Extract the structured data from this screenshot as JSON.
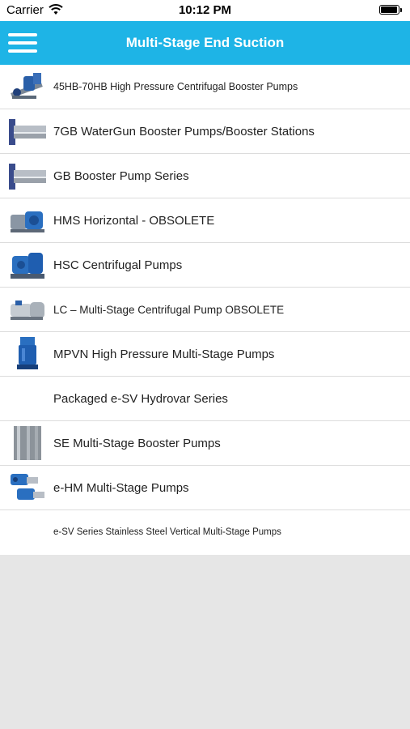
{
  "status_bar": {
    "carrier": "Carrier",
    "time": "10:12 PM",
    "wifi_icon": "wifi-icon",
    "battery_icon": "battery-icon"
  },
  "nav": {
    "title": "Multi-Stage End Suction",
    "menu_icon": "hamburger-menu-icon",
    "accent_color": "#1eb4e6"
  },
  "items": [
    {
      "label": "45HB-70HB High Pressure Centrifugal Booster Pumps",
      "thumb": "pump-image"
    },
    {
      "label": "7GB WaterGun Booster Pumps/Booster Stations",
      "thumb": "pump-image"
    },
    {
      "label": "GB Booster Pump Series",
      "thumb": "pump-image"
    },
    {
      "label": "HMS Horizontal - OBSOLETE",
      "thumb": "pump-image"
    },
    {
      "label": "HSC Centrifugal Pumps",
      "thumb": "pump-image"
    },
    {
      "label": "LC – Multi-Stage Centrifugal Pump   OBSOLETE",
      "thumb": "pump-image"
    },
    {
      "label": "MPVN High Pressure Multi-Stage Pumps",
      "thumb": "pump-image"
    },
    {
      "label": "Packaged e-SV Hydrovar Series",
      "thumb": ""
    },
    {
      "label": "SE Multi-Stage Booster Pumps",
      "thumb": "pump-image"
    },
    {
      "label": "e-HM Multi-Stage Pumps",
      "thumb": "pump-image"
    },
    {
      "label": "e-SV Series Stainless Steel Vertical Multi-Stage Pumps",
      "thumb": ""
    }
  ]
}
